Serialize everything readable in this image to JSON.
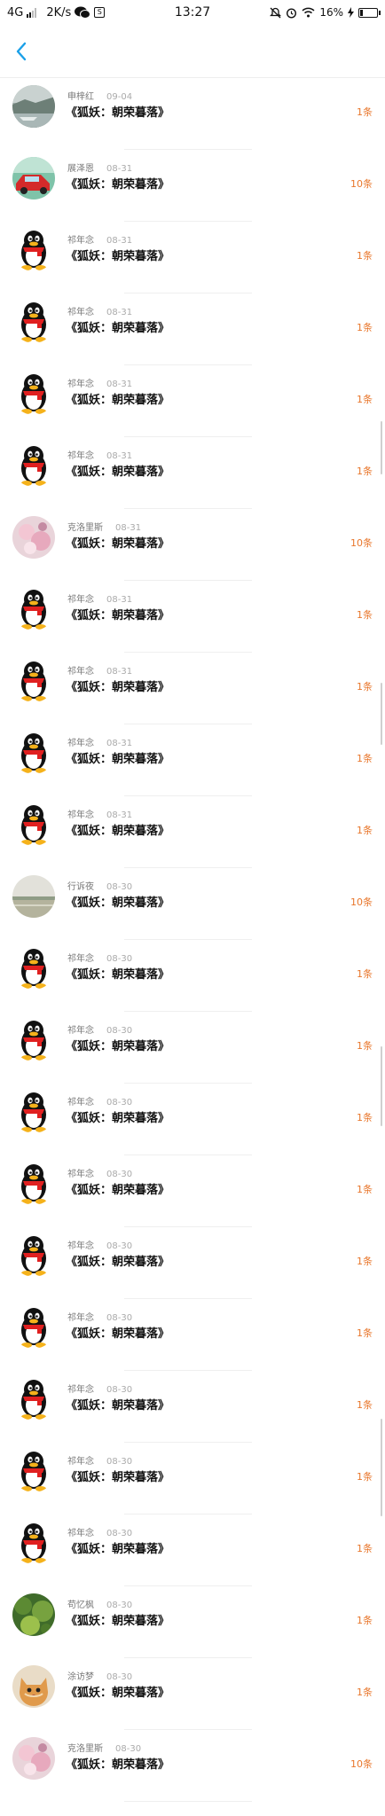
{
  "status_bar": {
    "network": "4G",
    "speed": "2K/s",
    "app_badge": "S",
    "time": "13:27",
    "battery": "16%",
    "battery_level": 0.16
  },
  "items": [
    {
      "name": "申梓红",
      "date": "09-04",
      "title": "《狐妖：朝荣暮落》",
      "count": "1条",
      "avatar": "photo-lake"
    },
    {
      "name": "展泽恩",
      "date": "08-31",
      "title": "《狐妖：朝荣暮落》",
      "count": "10条",
      "avatar": "photo-car"
    },
    {
      "name": "祁年念",
      "date": "08-31",
      "title": "《狐妖：朝荣暮落》",
      "count": "1条",
      "avatar": "qq-penguin"
    },
    {
      "name": "祁年念",
      "date": "08-31",
      "title": "《狐妖：朝荣暮落》",
      "count": "1条",
      "avatar": "qq-penguin"
    },
    {
      "name": "祁年念",
      "date": "08-31",
      "title": "《狐妖：朝荣暮落》",
      "count": "1条",
      "avatar": "qq-penguin"
    },
    {
      "name": "祁年念",
      "date": "08-31",
      "title": "《狐妖：朝荣暮落》",
      "count": "1条",
      "avatar": "qq-penguin"
    },
    {
      "name": "克洛里斯",
      "date": "08-31",
      "title": "《狐妖：朝荣暮落》",
      "count": "10条",
      "avatar": "photo-flowers"
    },
    {
      "name": "祁年念",
      "date": "08-31",
      "title": "《狐妖：朝荣暮落》",
      "count": "1条",
      "avatar": "qq-penguin"
    },
    {
      "name": "祁年念",
      "date": "08-31",
      "title": "《狐妖：朝荣暮落》",
      "count": "1条",
      "avatar": "qq-penguin"
    },
    {
      "name": "祁年念",
      "date": "08-31",
      "title": "《狐妖：朝荣暮落》",
      "count": "1条",
      "avatar": "qq-penguin"
    },
    {
      "name": "祁年念",
      "date": "08-31",
      "title": "《狐妖：朝荣暮落》",
      "count": "1条",
      "avatar": "qq-penguin"
    },
    {
      "name": "行诉夜",
      "date": "08-30",
      "title": "《狐妖：朝荣暮落》",
      "count": "10条",
      "avatar": "photo-field"
    },
    {
      "name": "祁年念",
      "date": "08-30",
      "title": "《狐妖：朝荣暮落》",
      "count": "1条",
      "avatar": "qq-penguin"
    },
    {
      "name": "祁年念",
      "date": "08-30",
      "title": "《狐妖：朝荣暮落》",
      "count": "1条",
      "avatar": "qq-penguin"
    },
    {
      "name": "祁年念",
      "date": "08-30",
      "title": "《狐妖：朝荣暮落》",
      "count": "1条",
      "avatar": "qq-penguin"
    },
    {
      "name": "祁年念",
      "date": "08-30",
      "title": "《狐妖：朝荣暮落》",
      "count": "1条",
      "avatar": "qq-penguin"
    },
    {
      "name": "祁年念",
      "date": "08-30",
      "title": "《狐妖：朝荣暮落》",
      "count": "1条",
      "avatar": "qq-penguin"
    },
    {
      "name": "祁年念",
      "date": "08-30",
      "title": "《狐妖：朝荣暮落》",
      "count": "1条",
      "avatar": "qq-penguin"
    },
    {
      "name": "祁年念",
      "date": "08-30",
      "title": "《狐妖：朝荣暮落》",
      "count": "1条",
      "avatar": "qq-penguin"
    },
    {
      "name": "祁年念",
      "date": "08-30",
      "title": "《狐妖：朝荣暮落》",
      "count": "1条",
      "avatar": "qq-penguin"
    },
    {
      "name": "祁年念",
      "date": "08-30",
      "title": "《狐妖：朝荣暮落》",
      "count": "1条",
      "avatar": "qq-penguin"
    },
    {
      "name": "苟忆枫",
      "date": "08-30",
      "title": "《狐妖：朝荣暮落》",
      "count": "1条",
      "avatar": "photo-greenery"
    },
    {
      "name": "涂访梦",
      "date": "08-30",
      "title": "《狐妖：朝荣暮落》",
      "count": "1条",
      "avatar": "photo-cat"
    },
    {
      "name": "克洛里斯",
      "date": "08-30",
      "title": "《狐妖：朝荣暮落》",
      "count": "10条",
      "avatar": "photo-flowers"
    }
  ],
  "colors": {
    "accent": "#1aa0e8",
    "count": "#e8762b"
  }
}
